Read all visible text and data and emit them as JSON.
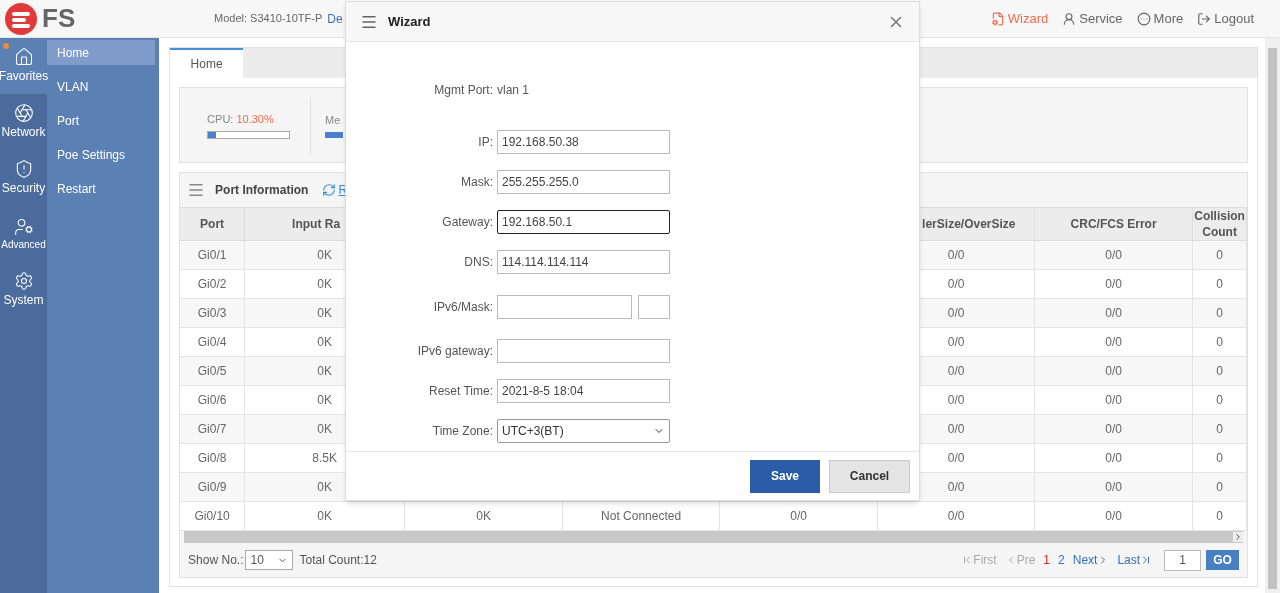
{
  "header": {
    "logo": "FS",
    "model": "Model: S3410-10TF-P",
    "model_link": "De",
    "actions": [
      {
        "kind": "wizard",
        "label": "Wizard",
        "selected": true
      },
      {
        "kind": "service",
        "label": "Service",
        "selected": false
      },
      {
        "kind": "more",
        "label": "More",
        "selected": false
      },
      {
        "kind": "logout",
        "label": "Logout",
        "selected": false
      }
    ]
  },
  "rail": [
    {
      "kind": "home",
      "label": "Favorites",
      "selected": true,
      "badge": true
    },
    {
      "kind": "network",
      "label": "Network",
      "selected": false,
      "badge": false
    },
    {
      "kind": "security",
      "label": "Security",
      "selected": false,
      "badge": false
    },
    {
      "kind": "advanced",
      "label": "Advanced",
      "selected": false,
      "badge": false
    },
    {
      "kind": "system",
      "label": "System",
      "selected": false,
      "badge": false
    }
  ],
  "menu": [
    {
      "label": "Home",
      "selected": true
    },
    {
      "label": "VLAN",
      "selected": false
    },
    {
      "label": "Port",
      "selected": false
    },
    {
      "label": "Poe Settings",
      "selected": false
    },
    {
      "label": "Restart",
      "selected": false
    }
  ],
  "tabs": [
    {
      "label": "Home",
      "selected": true
    }
  ],
  "stats": {
    "cpu": {
      "label": "CPU:",
      "value": "10.30%",
      "level": 0.1
    },
    "memory": {
      "label": "Me"
    }
  },
  "port_info": {
    "title": "Port Information",
    "refresh": "R",
    "columns": [
      "Port",
      "Input Ra",
      null,
      null,
      null,
      "lerSize/OverSize",
      "CRC/FCS Error",
      "Collision Count"
    ],
    "rows": [
      [
        "Gi0/1",
        "0K",
        null,
        null,
        null,
        "0/0",
        "0/0",
        "0"
      ],
      [
        "Gi0/2",
        "0K",
        null,
        null,
        null,
        "0/0",
        "0/0",
        "0"
      ],
      [
        "Gi0/3",
        "0K",
        null,
        null,
        null,
        "0/0",
        "0/0",
        "0"
      ],
      [
        "Gi0/4",
        "0K",
        null,
        null,
        null,
        "0/0",
        "0/0",
        "0"
      ],
      [
        "Gi0/5",
        "0K",
        null,
        null,
        null,
        "0/0",
        "0/0",
        "0"
      ],
      [
        "Gi0/6",
        "0K",
        null,
        null,
        null,
        "0/0",
        "0/0",
        "0"
      ],
      [
        "Gi0/7",
        "0K",
        null,
        null,
        null,
        "0/0",
        "0/0",
        "0"
      ],
      [
        "Gi0/8",
        "8.5K",
        null,
        null,
        null,
        "0/0",
        "0/0",
        "0"
      ],
      [
        "Gi0/9",
        "0K",
        null,
        null,
        null,
        "0/0",
        "0/0",
        "0"
      ],
      [
        "Gi0/10",
        "0K",
        "0K",
        "Not Connected",
        "0/0",
        "0/0",
        "0/0",
        "0"
      ]
    ],
    "footer": {
      "show_label": "Show No.:",
      "show_value": "10",
      "total": "Total Count:12",
      "first": {
        "label": "First",
        "disabled": true
      },
      "prev": {
        "label": "Pre",
        "disabled": true
      },
      "pages": [
        {
          "label": "1",
          "selected": true
        },
        {
          "label": "2",
          "selected": false
        }
      ],
      "next": {
        "label": "Next",
        "disabled": false
      },
      "last": {
        "label": "Last",
        "disabled": false
      },
      "page_input": "1",
      "go": "GO"
    }
  },
  "dialog": {
    "title": "Wizard",
    "fields": [
      {
        "kind": "static",
        "label": "Mgmt Port:",
        "value": "vlan 1"
      },
      {
        "kind": "text",
        "label": "IP:",
        "value": "192.168.50.38",
        "focused": false
      },
      {
        "kind": "text",
        "label": "Mask:",
        "value": "255.255.255.0",
        "focused": false
      },
      {
        "kind": "text",
        "label": "Gateway:",
        "value": "192.168.50.1",
        "focused": true
      },
      {
        "kind": "text",
        "label": "DNS:",
        "value": "114.114.114.114",
        "focused": false
      },
      {
        "kind": "pair",
        "label": "IPv6/Mask:"
      },
      {
        "kind": "text",
        "label": "IPv6 gateway:",
        "focused": false
      },
      {
        "kind": "text",
        "label": "Reset Time:",
        "value": "2021-8-5 18:04",
        "focused": false
      },
      {
        "kind": "select",
        "label": "Time Zone:",
        "value": "UTC+3(BT)"
      }
    ],
    "buttons": [
      {
        "kind": "primary",
        "label": "Save"
      },
      {
        "kind": "secondary",
        "label": "Cancel"
      }
    ]
  }
}
